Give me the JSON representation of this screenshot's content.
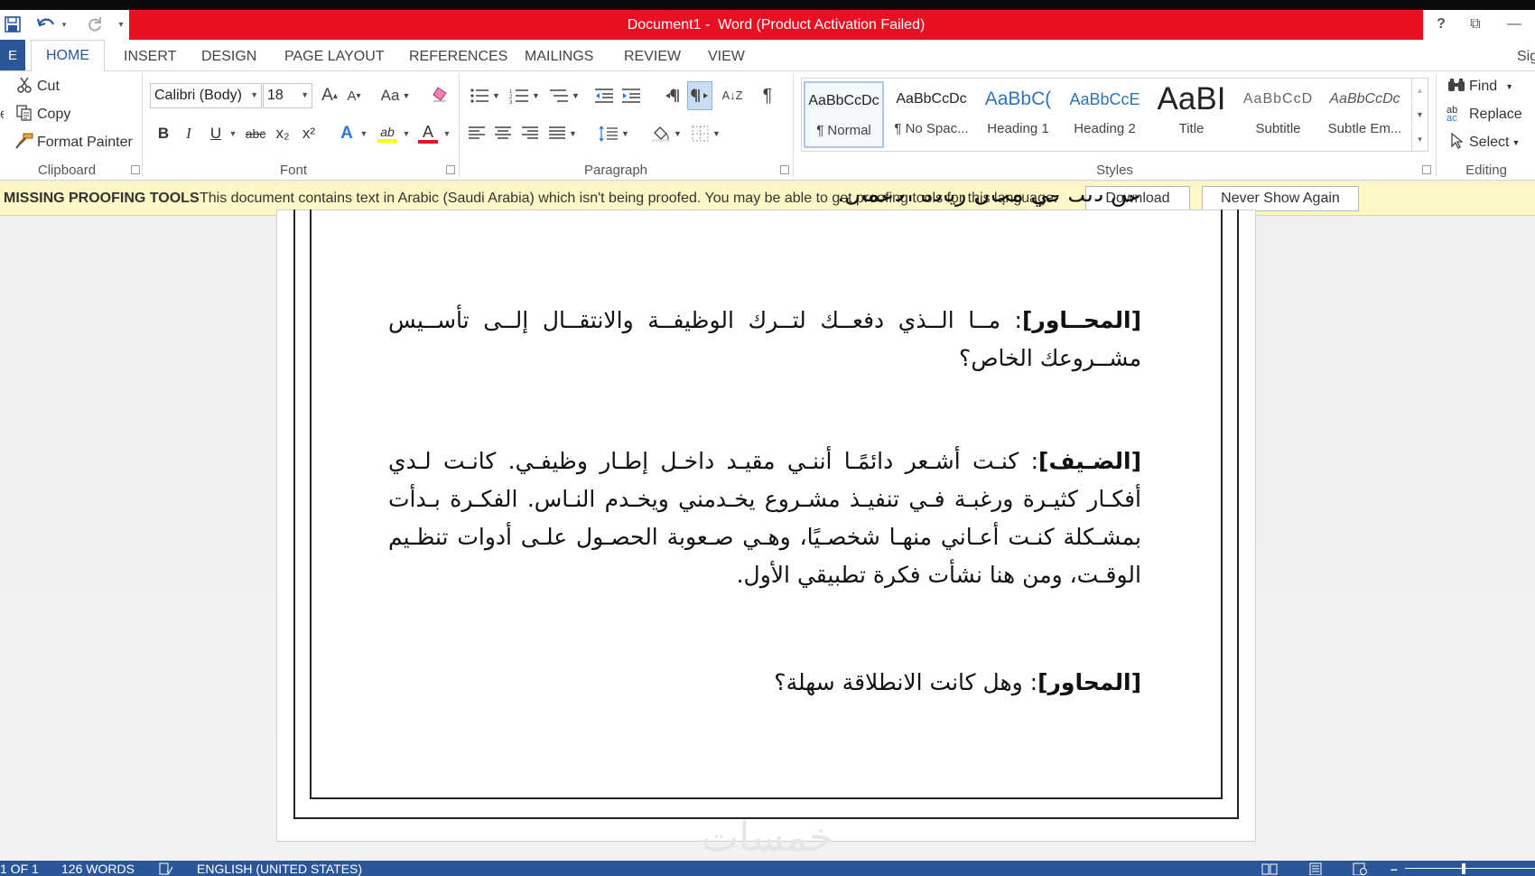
{
  "window": {
    "title": "Document1 -  Word (Product Activation Failed)",
    "title_bg": "#e81123",
    "accent": "#2b579a",
    "help_glyph": "?",
    "restore_glyph": "⧉",
    "minimize_glyph": "—"
  },
  "quick_access": {
    "save_glyph": "🖫",
    "undo_glyph": "↶",
    "redo_glyph": "↻",
    "customize_glyph": "▾"
  },
  "tabs": {
    "file": "E",
    "items": [
      "HOME",
      "INSERT",
      "DESIGN",
      "PAGE LAYOUT",
      "REFERENCES",
      "MAILINGS",
      "REVIEW",
      "VIEW"
    ],
    "active": "HOME",
    "sign_in": "Sig"
  },
  "ribbon": {
    "clipboard": {
      "label": "Clipboard",
      "cut": "Cut",
      "copy": "Copy",
      "format_painter": "Format Painter",
      "paste_fragment": "e"
    },
    "font": {
      "label": "Font",
      "font_name": "Calibri (Body)",
      "font_size": "18",
      "grow_glyph": "A",
      "shrink_glyph": "A",
      "change_case": "Aa",
      "bold": "B",
      "italic": "I",
      "underline": "U",
      "strike": "abc",
      "subscript": "x₂",
      "superscript": "x²",
      "text_effects": "A",
      "highlight": "ab",
      "font_color": "A",
      "font_color_value": "#e81123",
      "highlight_color_value": "#ffff00"
    },
    "paragraph": {
      "label": "Paragraph",
      "show_marks": "¶",
      "sort": "A↓Z"
    },
    "styles": {
      "label": "Styles",
      "items": [
        {
          "preview": "AaBbCcDc",
          "name": "¶ Normal"
        },
        {
          "preview": "AaBbCcDc",
          "name": "¶ No Spac..."
        },
        {
          "preview": "AaBbC(",
          "name": "Heading 1"
        },
        {
          "preview": "AaBbCcE",
          "name": "Heading 2"
        },
        {
          "preview": "AaBI",
          "name": "Title"
        },
        {
          "preview": "AaBbCcD",
          "name": "Subtitle"
        },
        {
          "preview": "AaBbCcDc",
          "name": "Subtle Em..."
        }
      ]
    },
    "editing": {
      "label": "Editing",
      "find": "Find",
      "replace": "Replace",
      "select": "Select"
    }
  },
  "message_bar": {
    "title": "MISSING PROOFING TOOLS",
    "text": "This document contains text in Arabic (Saudi Arabia) which isn't being proofed. You may be able to get proofing tools for this language.",
    "download": "Download",
    "never_show": "Never Show Again"
  },
  "document": {
    "partial_top_line": "عن ذلك في مجال ريادة الأعمال.",
    "paragraphs": [
      {
        "speaker": "[المحــاور]",
        "text": ": مــا الــذي دفعــك لتــرك الوظيفــة والانتقــال إلــى تأســيس مشــروعك الخاص؟"
      },
      {
        "speaker": "[الضـيف]",
        "text": ": كنـت أشـعر دائمًـا أننـي مقيـد داخـل إطـار وظيفـي. كانـت لـدي أفكـار كثيـرة ورغبـة فـي تنفيـذ مشـروع يخـدمني ويخـدم النـاس. الفكـرة بـدأت بمشـكلة كنـت أعـاني منهـا شخصـيًا، وهـي صـعوبة الحصـول علـى أدوات تنظـيم الوقـت، ومن هنا نشأت فكرة تطبيقي الأول."
      },
      {
        "speaker": "[المحاور]",
        "text": ": وهل كانت الانطلاقة سهلة؟"
      }
    ],
    "watermark": "خمسات"
  },
  "status_bar": {
    "page": "1 OF 1",
    "words": "126 WORDS",
    "language": "ENGLISH (UNITED STATES)"
  }
}
